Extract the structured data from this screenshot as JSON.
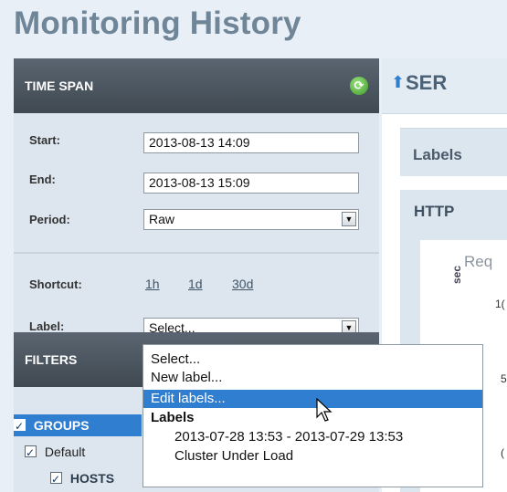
{
  "page": {
    "title": "Monitoring History"
  },
  "time_span": {
    "header": "TIME SPAN",
    "start_label": "Start:",
    "start_value": "2013-08-13 14:09",
    "end_label": "End:",
    "end_value": "2013-08-13 15:09",
    "period_label": "Period:",
    "period_value": "Raw",
    "shortcut_label": "Shortcut:",
    "shortcuts": [
      "1h",
      "1d",
      "30d"
    ],
    "label_label": "Label:",
    "label_value": "Select..."
  },
  "dropdown": {
    "items": [
      "Select...",
      "New label...",
      "Edit labels..."
    ],
    "selected_index": 2,
    "group_label": "Labels",
    "group_items": [
      "2013-07-28 13:53 - 2013-07-29 13:53",
      "Cluster Under Load"
    ]
  },
  "filters": {
    "header": "FILTERS",
    "groups_label": "GROUPS",
    "default_label": "Default",
    "hosts_label": "HOSTS"
  },
  "main": {
    "header_partial": "SER",
    "labels_panel_partial": "Labels",
    "http_title": "HTTP",
    "chart_title_partial": "Req",
    "axis_unit_partial": "sec",
    "ticks": [
      "1(",
      "5",
      "("
    ]
  },
  "colors": {
    "accent": "#2f7ed0",
    "header_dark": "#4a545e",
    "title": "#6f8598",
    "panel_bg": "#dde6ef"
  },
  "icons": {
    "refresh": "refresh-icon",
    "arrow": "up-arrow-icon",
    "cursor": "mouse-cursor-icon",
    "dropdown": "chevron-down-icon"
  }
}
